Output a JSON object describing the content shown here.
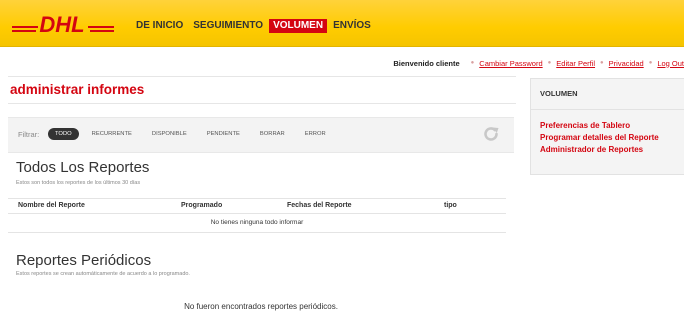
{
  "brand": {
    "logo_text": "DHL",
    "logo_color": "#d40511",
    "header_color": "#ffcc00"
  },
  "nav": {
    "items": [
      {
        "label": "DE INICIO",
        "active": false
      },
      {
        "label": "SEGUIMIENTO",
        "active": false
      },
      {
        "label": "VOLUMEN",
        "active": true
      },
      {
        "label": "ENVÍOS",
        "active": false
      }
    ]
  },
  "userbar": {
    "welcome": "Bienvenido cliente",
    "links": [
      "Cambiar Password",
      "Editar Perfil",
      "Privacidad",
      "Log Out"
    ]
  },
  "page": {
    "title": "administrar informes"
  },
  "sidepanel": {
    "heading": "VOLUMEN",
    "links": [
      "Preferencias de Tablero",
      "Programar detalles del Reporte",
      "Administrador de Reportes"
    ]
  },
  "filter": {
    "label": "Filtrar:",
    "options": [
      "TODO",
      "RECURRENTE",
      "DISPONIBLE",
      "PENDIENTE",
      "BORRAR",
      "ERROR"
    ],
    "selected": "TODO",
    "refresh_icon": "refresh-icon"
  },
  "all_reports": {
    "title": "Todos Los Reportes",
    "subtitle": "Estos son todos los reportes de los últimos 30 días",
    "columns": [
      "Nombre del Reporte",
      "Programado",
      "Fechas del Reporte",
      "tipo"
    ],
    "empty_text": "No tienes ninguna todo informar"
  },
  "periodic_reports": {
    "title": "Reportes Periódicos",
    "subtitle": "Estos reportes se crean automáticamente de acuerdo a lo programado.",
    "empty_text": "No fueron encontrados reportes periódicos."
  }
}
